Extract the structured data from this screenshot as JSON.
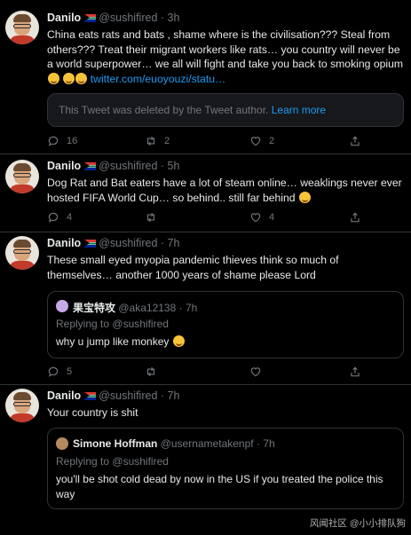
{
  "tweets": [
    {
      "name": "Danilo",
      "handle": "@sushifired",
      "time": "· 3h",
      "text": "China eats rats and bats , shame where is the civilisation??? Steal from others??? Treat their migrant workers like rats… you country will never be a world superpower… we all will fight and take you back to smoking opium",
      "link": "twitter.com/euoyouzi/statu…",
      "link_suffix": "",
      "deleted_notice": "This Tweet was deleted by the Tweet author.",
      "learn_more": "Learn more",
      "replies": "16",
      "retweets": "2",
      "likes": "2"
    },
    {
      "name": "Danilo",
      "handle": "@sushifired",
      "time": "· 5h",
      "text": "Dog Rat and Bat eaters have a lot of steam online… weaklings never ever hosted FIFA World Cup… so behind.. still far behind",
      "replies": "4",
      "retweets": "",
      "likes": "4"
    },
    {
      "name": "Danilo",
      "handle": "@sushifired",
      "time": "· 7h",
      "text": "These small eyed myopia pandemic thieves think so much of themselves… another 1000 years of shame please Lord",
      "quote": {
        "name": "果宝特攻",
        "handle": "@aka12138",
        "time": "· 7h",
        "replying_label": "Replying to",
        "replying_handle": "@sushifired",
        "text": "why u jump like monkey"
      },
      "replies": "5",
      "retweets": "",
      "likes": ""
    },
    {
      "name": "Danilo",
      "handle": "@sushifired",
      "time": "· 7h",
      "text": "Your country is shit",
      "quote": {
        "name": "Simone Hoffman",
        "handle": "@usernametakenpf",
        "time": "· 7h",
        "replying_label": "Replying to",
        "replying_handle": "@sushifired",
        "text": "you'll be shot cold dead by now in the US if you treated the police this way"
      }
    }
  ],
  "watermark": "风闻社区 @小小排队狗",
  "colors": {
    "background": "#000000",
    "link": "#1d9bf0",
    "muted": "#71767b",
    "border": "#2f3336"
  }
}
